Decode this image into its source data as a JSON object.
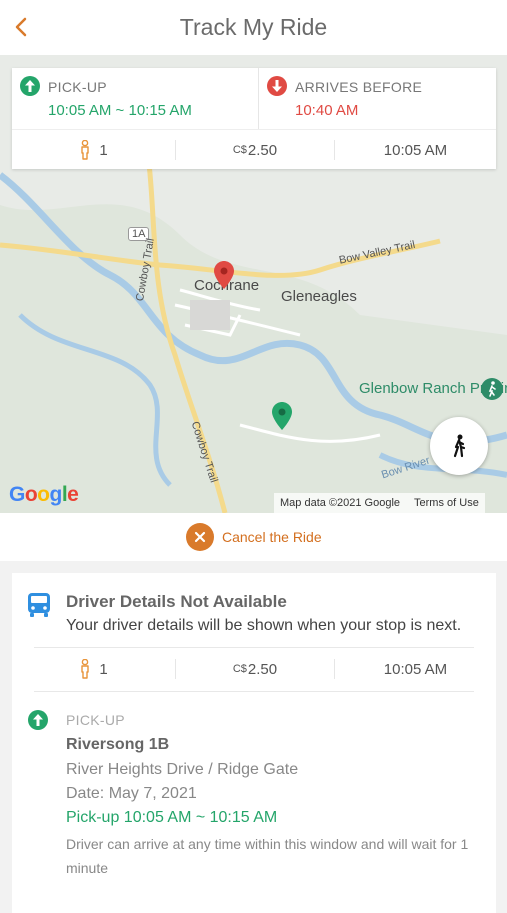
{
  "header": {
    "title": "Track My Ride",
    "back_icon": "chevron-left-icon",
    "accent": "#d97a2b"
  },
  "summary": {
    "pickup": {
      "label": "PICK-UP",
      "time": "10:05 AM ~ 10:15 AM",
      "icon": "arrow-up-circle-icon",
      "color": "#24a56a"
    },
    "arrives": {
      "label": "ARRIVES BEFORE",
      "time": "10:40 AM",
      "icon": "arrow-down-circle-icon",
      "color": "#e04a43"
    },
    "passengers": "1",
    "fare_currency": "C$",
    "fare_amount": "2.50",
    "time": "10:05 AM"
  },
  "map": {
    "labels": {
      "cochrane": "Cochrane",
      "gleneagles": "Gleneagles",
      "bow_valley_trail": "Bow Valley Trail",
      "cowboy_trail_1": "Cowboy Trail",
      "cowboy_trail_2": "Cowboy Trail",
      "route_1a": "1A",
      "park": "Glenbow Ranch Provincial Park",
      "bow_river": "Bow River"
    },
    "logo": "Google",
    "attribution": {
      "data": "Map data ©2021 Google",
      "terms": "Terms of Use"
    },
    "walk_icon": "walking-person-icon"
  },
  "cancel": {
    "label": "Cancel the Ride",
    "icon": "close-circle-icon"
  },
  "driver": {
    "title": "Driver Details Not Available",
    "subtitle": "Your driver details will be shown when your stop is next.",
    "icon": "bus-icon",
    "passengers": "1",
    "fare_currency": "C$",
    "fare_amount": "2.50",
    "time": "10:05 AM"
  },
  "stop": {
    "label": "PICK-UP",
    "name": "Riversong 1B",
    "address": "River Heights Drive / Ridge Gate",
    "date": "Date: May 7, 2021",
    "window": "Pick-up 10:05 AM ~ 10:15 AM",
    "note": "Driver can arrive at any time within this window and will wait for 1 minute"
  }
}
